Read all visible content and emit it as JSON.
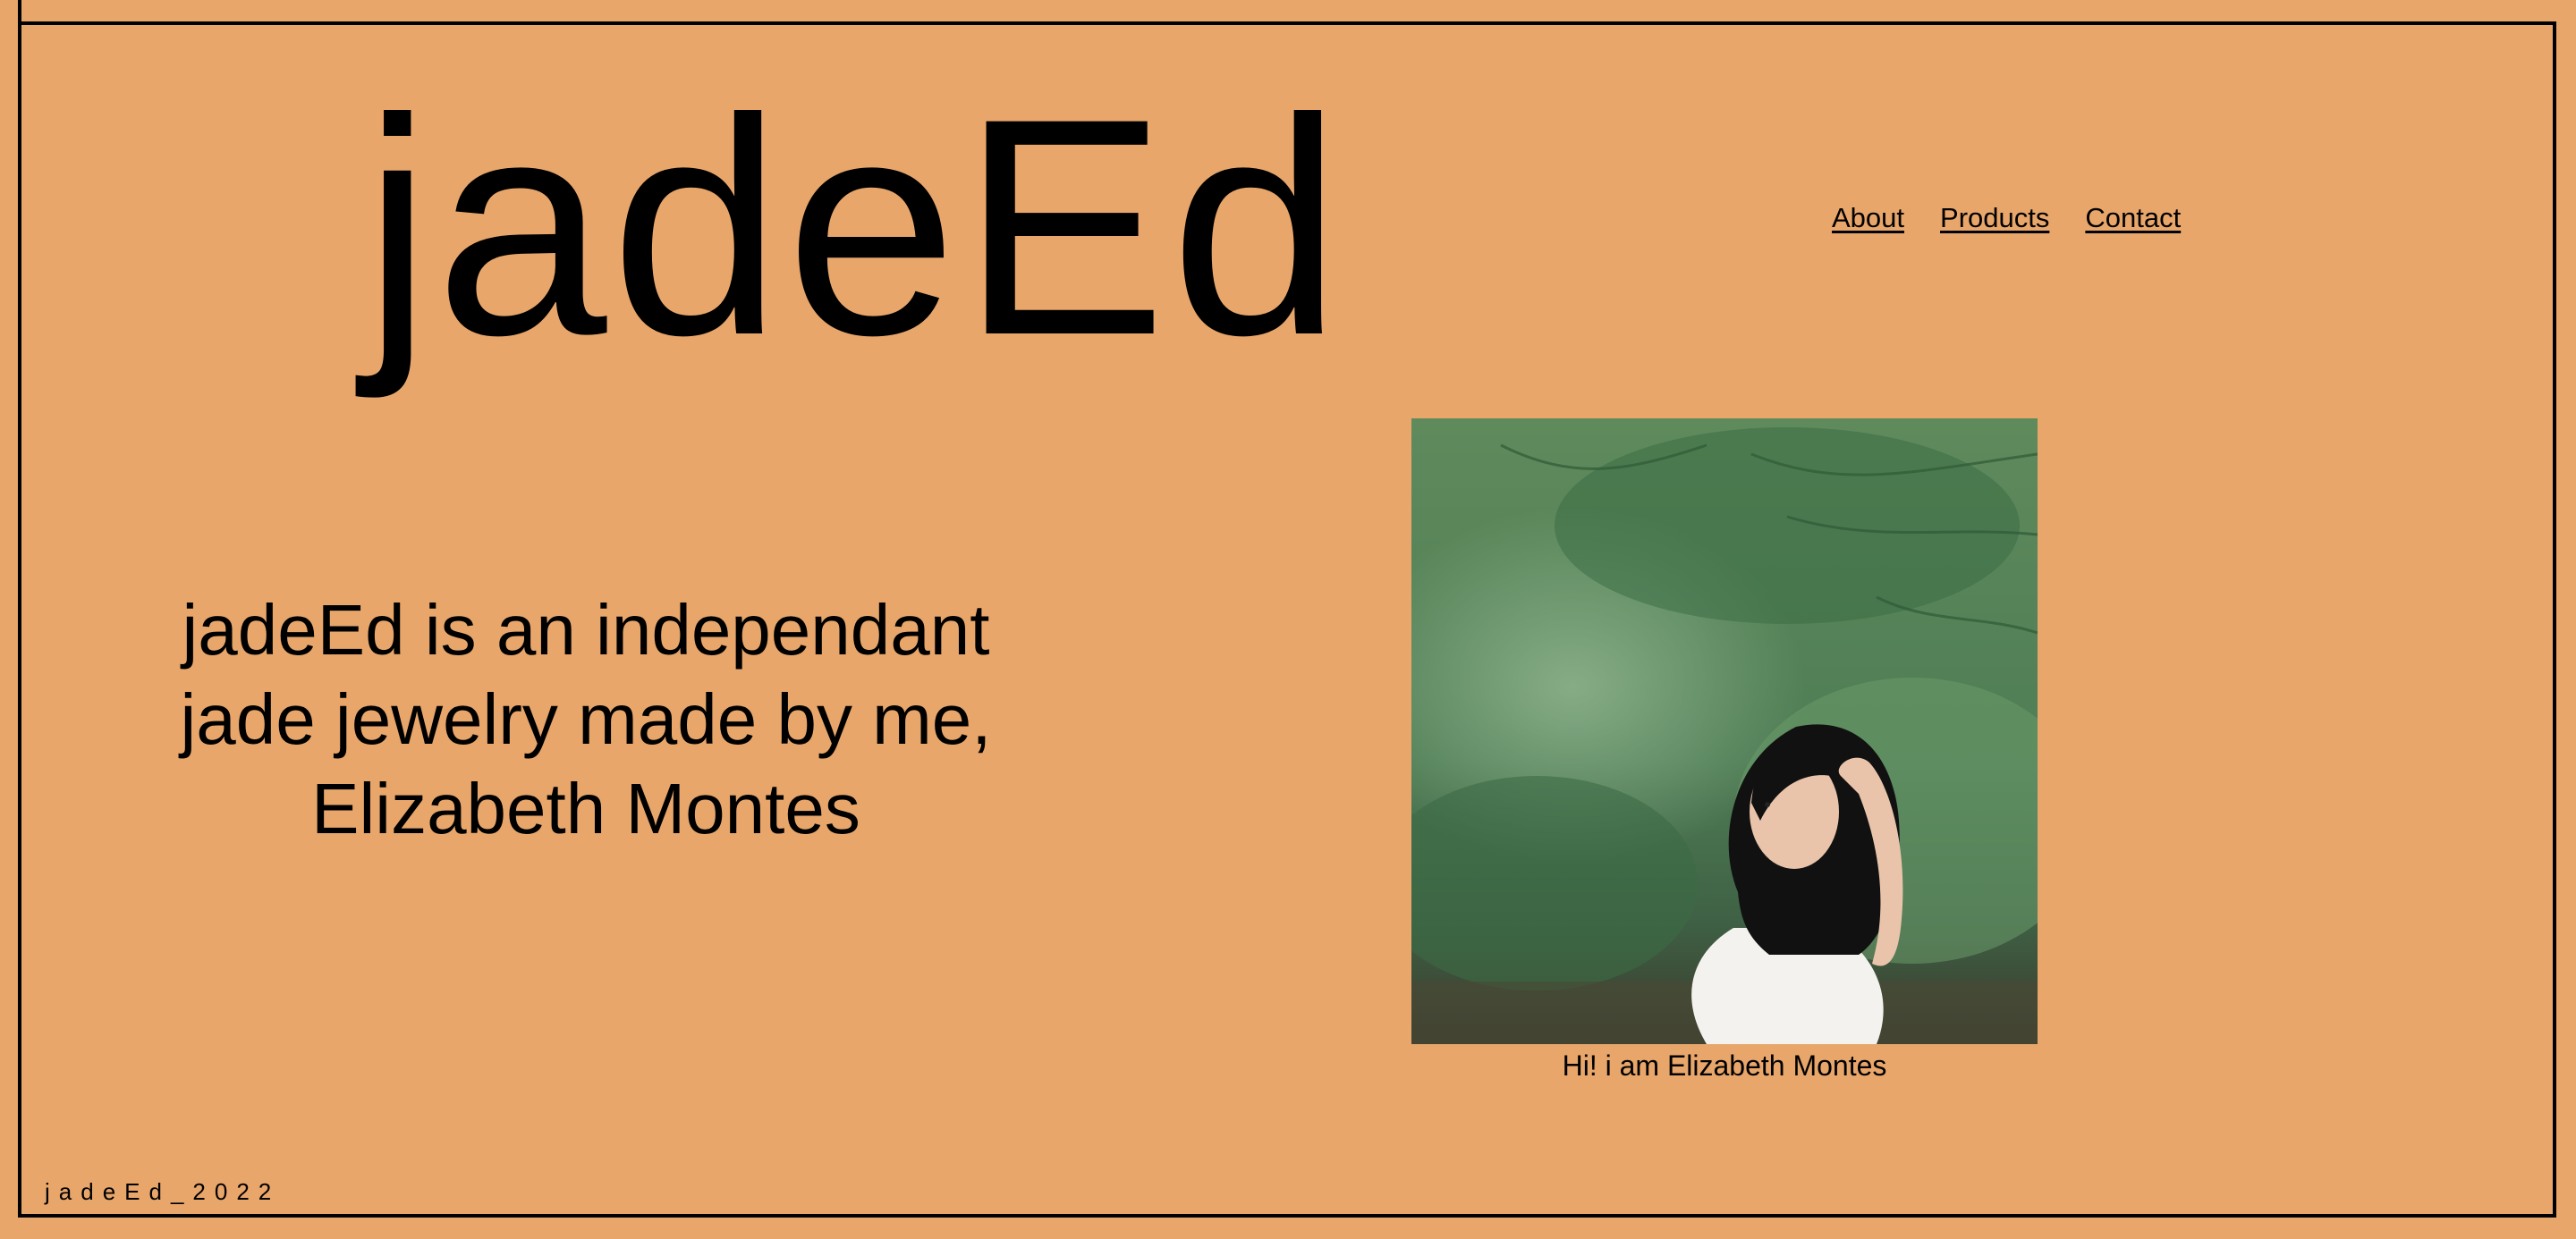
{
  "site": {
    "brand": "jadeEd",
    "nav": [
      {
        "label": "About"
      },
      {
        "label": "Products"
      },
      {
        "label": "Contact"
      }
    ]
  },
  "hero": {
    "intro": "jadeEd is an independant jade jewelry made by me, Elizabeth Montes",
    "photo_caption": "Hi! i am Elizabeth Montes"
  },
  "footer": {
    "text": "jadeEd_2022"
  },
  "colors": {
    "background": "#e8a66b",
    "frame": "#000000"
  }
}
